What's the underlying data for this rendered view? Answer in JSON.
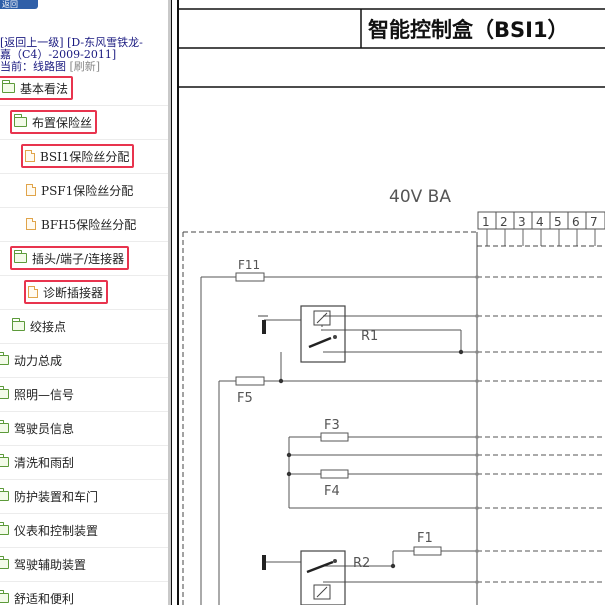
{
  "sidebar": {
    "top_button": "返回",
    "back_link": "[返回上一级]",
    "vehicle_line1": "[D-东风雪铁龙-",
    "vehicle_line2": "嘉（C4）-2009-2011]",
    "current_prefix": "当前：",
    "current_value": "线路图",
    "refresh": "[刷新]",
    "items": [
      {
        "label": "基本看法",
        "icon": "folder-open-icon"
      },
      {
        "label": "布置保险丝",
        "icon": "folder-open-icon"
      },
      {
        "label": "BSI1保险丝分配",
        "icon": "document-icon"
      },
      {
        "label": "PSF1保险丝分配",
        "icon": "document-icon"
      },
      {
        "label": "BFH5保险丝分配",
        "icon": "document-icon"
      },
      {
        "label": "插头/端子/连接器",
        "icon": "folder-open-icon"
      },
      {
        "label": "诊断插接器",
        "icon": "document-icon"
      },
      {
        "label": "绞接点",
        "icon": "folder-open-icon"
      },
      {
        "label": "动力总成",
        "icon": "folder-icon"
      },
      {
        "label": "照明—信号",
        "icon": "folder-icon"
      },
      {
        "label": "驾驶员信息",
        "icon": "folder-icon"
      },
      {
        "label": "清洗和雨刮",
        "icon": "folder-icon"
      },
      {
        "label": "防护装置和车门",
        "icon": "folder-icon"
      },
      {
        "label": "仪表和控制装置",
        "icon": "folder-icon"
      },
      {
        "label": "驾驶辅助装置",
        "icon": "folder-icon"
      },
      {
        "label": "舒适和便利",
        "icon": "folder-icon"
      }
    ]
  },
  "diagram": {
    "title": "智能控制盒（BSI1）",
    "supply_label": "40V BA",
    "pins": [
      "1",
      "2",
      "3",
      "4",
      "5",
      "6",
      "7"
    ],
    "fuses": [
      "F11",
      "F5",
      "F3",
      "F4",
      "F1"
    ],
    "relays": [
      "R1",
      "R2"
    ]
  }
}
